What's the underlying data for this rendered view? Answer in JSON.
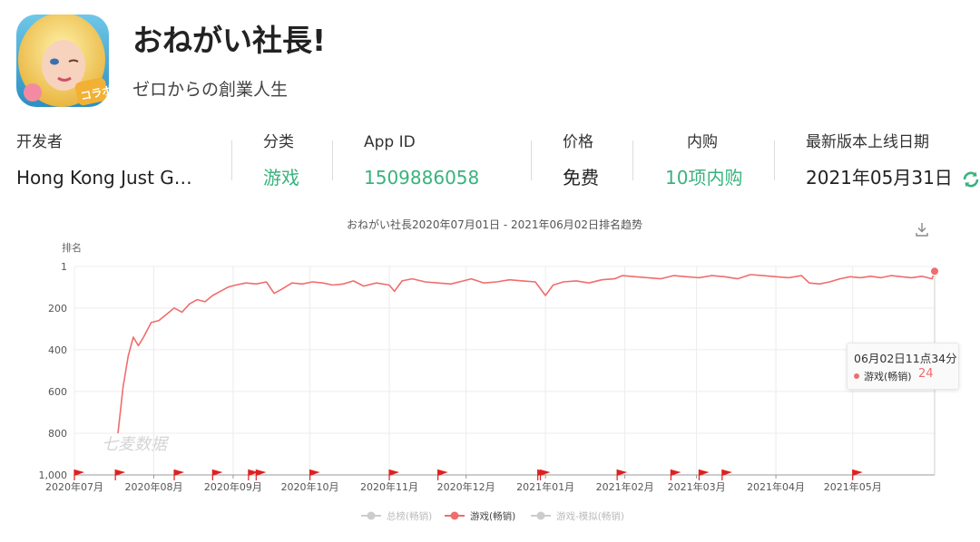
{
  "app": {
    "title": "おねがい社長!",
    "subtitle": "ゼロからの創業人生",
    "icon_badge": "コラボ"
  },
  "info": [
    {
      "key": "developer",
      "label": "开发者",
      "value": "Hong Kong Just G…",
      "green": false
    },
    {
      "key": "category",
      "label": "分类",
      "value": "游戏",
      "green": true
    },
    {
      "key": "app-id",
      "label": "App ID",
      "value": "1509886058",
      "green": true
    },
    {
      "key": "price",
      "label": "价格",
      "value": "免费",
      "green": false
    },
    {
      "key": "iap",
      "label": "内购",
      "value": "10项内购",
      "green": true
    },
    {
      "key": "release-date",
      "label": "最新版本上线日期",
      "value": "2021年05月31日",
      "green": false
    }
  ],
  "colors": {
    "accent_green": "#3ab27e",
    "series_red": "#f06d6d",
    "inactive_gray": "#cccccc"
  },
  "icons": {
    "refresh": "refresh-icon",
    "download": "download-icon",
    "flag": "flag-icon"
  },
  "watermark": "七麦数据",
  "tooltip": {
    "time": "06月02日11点34分",
    "series": "游戏(畅销)",
    "value": "24"
  },
  "chart_data": {
    "type": "line",
    "title": "おねがい社長2020年07月01日 - 2021年06月02日排名趋势",
    "ylabel": "排名",
    "yaxis_inverted": true,
    "ylim": [
      1,
      1000
    ],
    "yticks": [
      1,
      200,
      400,
      600,
      800,
      1000
    ],
    "ytick_labels": [
      "1",
      "200",
      "400",
      "600",
      "800",
      "1,000"
    ],
    "xlim": [
      "2020-07-01",
      "2021-06-02"
    ],
    "xticks": [
      "2020-07-01",
      "2020-08-01",
      "2020-09-01",
      "2020-10-01",
      "2020-11-01",
      "2020-12-01",
      "2021-01-01",
      "2021-02-01",
      "2021-03-01",
      "2021-04-01",
      "2021-05-01"
    ],
    "xtick_labels": [
      "2020年07月",
      "2020年08月",
      "2020年09月",
      "2020年10月",
      "2020年11月",
      "2020年12月",
      "2021年01月",
      "2021年02月",
      "2021年03月",
      "2021年04月",
      "2021年05月"
    ],
    "grid": true,
    "legend_position": "bottom",
    "legend": [
      {
        "name": "总榜(畅销)",
        "active": false
      },
      {
        "name": "游戏(畅销)",
        "active": true
      },
      {
        "name": "游戏-模拟(畅销)",
        "active": false
      }
    ],
    "series": [
      {
        "name": "游戏(畅销)",
        "x": [
          "2020-07-18",
          "2020-07-20",
          "2020-07-22",
          "2020-07-24",
          "2020-07-26",
          "2020-07-28",
          "2020-07-31",
          "2020-08-03",
          "2020-08-06",
          "2020-08-09",
          "2020-08-12",
          "2020-08-15",
          "2020-08-18",
          "2020-08-21",
          "2020-08-24",
          "2020-08-27",
          "2020-08-30",
          "2020-09-02",
          "2020-09-06",
          "2020-09-10",
          "2020-09-14",
          "2020-09-17",
          "2020-09-20",
          "2020-09-24",
          "2020-09-28",
          "2020-10-02",
          "2020-10-06",
          "2020-10-10",
          "2020-10-14",
          "2020-10-18",
          "2020-10-22",
          "2020-10-27",
          "2020-11-01",
          "2020-11-03",
          "2020-11-06",
          "2020-11-10",
          "2020-11-15",
          "2020-11-20",
          "2020-11-25",
          "2020-11-30",
          "2020-12-03",
          "2020-12-08",
          "2020-12-13",
          "2020-12-18",
          "2020-12-23",
          "2020-12-28",
          "2021-01-01",
          "2021-01-04",
          "2021-01-08",
          "2021-01-13",
          "2021-01-18",
          "2021-01-23",
          "2021-01-28",
          "2021-01-31",
          "2021-02-05",
          "2021-02-10",
          "2021-02-15",
          "2021-02-20",
          "2021-02-25",
          "2021-03-02",
          "2021-03-07",
          "2021-03-12",
          "2021-03-17",
          "2021-03-22",
          "2021-03-27",
          "2021-04-01",
          "2021-04-06",
          "2021-04-11",
          "2021-04-14",
          "2021-04-18",
          "2021-04-22",
          "2021-04-26",
          "2021-04-30",
          "2021-05-04",
          "2021-05-08",
          "2021-05-12",
          "2021-05-16",
          "2021-05-20",
          "2021-05-24",
          "2021-05-28",
          "2021-06-01",
          "2021-06-02"
        ],
        "values": [
          800,
          580,
          430,
          340,
          380,
          340,
          270,
          260,
          230,
          200,
          220,
          180,
          160,
          170,
          140,
          120,
          100,
          90,
          80,
          85,
          75,
          130,
          110,
          80,
          85,
          75,
          80,
          90,
          85,
          70,
          95,
          80,
          90,
          120,
          70,
          60,
          75,
          80,
          85,
          70,
          60,
          80,
          75,
          65,
          70,
          75,
          140,
          90,
          75,
          70,
          80,
          65,
          60,
          45,
          50,
          55,
          60,
          45,
          50,
          55,
          45,
          50,
          60,
          40,
          45,
          50,
          55,
          45,
          80,
          85,
          75,
          60,
          50,
          55,
          48,
          55,
          45,
          50,
          55,
          48,
          60,
          24
        ]
      }
    ],
    "event_flags": [
      "2020-07-01",
      "2020-07-17",
      "2020-08-09",
      "2020-08-24",
      "2020-09-07",
      "2020-09-10",
      "2020-10-01",
      "2020-11-01",
      "2020-11-20",
      "2020-12-29",
      "2020-12-30",
      "2021-01-29",
      "2021-02-19",
      "2021-03-02",
      "2021-03-11",
      "2021-05-01"
    ],
    "tooltip_point": {
      "x": "2021-06-02",
      "value": 24
    }
  }
}
